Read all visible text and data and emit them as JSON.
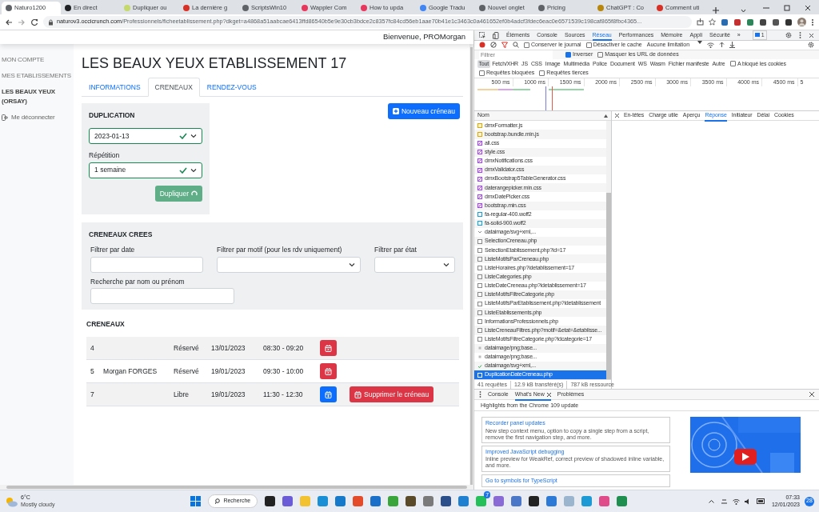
{
  "browser": {
    "tabs": [
      {
        "title": "Naturo1200",
        "selected": true,
        "color": "#5f6368"
      },
      {
        "title": "En direct",
        "selected": false,
        "color": "#202124"
      },
      {
        "title": "Dupliquer ou",
        "selected": false,
        "color": "#c5d96a"
      },
      {
        "title": "La dernière g",
        "selected": false,
        "color": "#d93025"
      },
      {
        "title": "ScriptsWin10",
        "selected": false,
        "color": "#5f6368"
      },
      {
        "title": "Wappler Com",
        "selected": false,
        "color": "#e8365d"
      },
      {
        "title": "How to upda",
        "selected": false,
        "color": "#e8365d"
      },
      {
        "title": "Google Tradu",
        "selected": false,
        "color": "#4285f4"
      },
      {
        "title": "Nouvel onglet",
        "selected": false,
        "color": "#5f6368"
      },
      {
        "title": "Pricing",
        "selected": false,
        "color": "#5f6368"
      },
      {
        "title": "ChatGPT : Co",
        "selected": false,
        "color": "#b8860b"
      },
      {
        "title": "Comment uti",
        "selected": false,
        "color": "#d93025"
      }
    ],
    "url_host": "naturov3.occicrunch.com",
    "url_rest": "/Professionnels/ficheetablissement.php?dkget=a4868a51aabcae6413ffd86540b5e9e30cb3bdce2c8357fc84cd56eb1aae70b41e1c3463c0a461652ef0b4adcf3fdec6eac0e6571539c198caf865f8fbc4365..."
  },
  "page": {
    "welcome": "Bienvenue, PROMorgan",
    "sidebar": [
      {
        "label": "MON COMPTE",
        "selected": false
      },
      {
        "label": "MES ETABLISSEMENTS",
        "selected": false
      },
      {
        "label": "LES BEAUX YEUX (ORSAY)",
        "selected": true
      }
    ],
    "logout": "Me déconnecter",
    "title": "LES BEAUX YEUX ETABLISSEMENT 17",
    "tabs": [
      {
        "label": "INFORMATIONS",
        "selected": false
      },
      {
        "label": "CRENEAUX",
        "selected": true
      },
      {
        "label": "RENDEZ-VOUS",
        "selected": false
      }
    ],
    "duplication": {
      "heading": "DUPLICATION",
      "date_value": "2023-01-13",
      "date_valid": true,
      "repetition_label": "Répétition",
      "repetition_value": "1 semaine",
      "repetition_valid": true,
      "button": "Dupliquer",
      "loading": true
    },
    "new_button": "Nouveau créneau",
    "filters": {
      "heading": "CRENEAUX CREES",
      "fields": [
        {
          "label": "Filtrer par date",
          "kind": "text"
        },
        {
          "label": "Filtrer par motif (pour les rdv uniquement)",
          "kind": "select"
        },
        {
          "label": "Filtrer par état",
          "kind": "select"
        },
        {
          "label": "Recherche par nom ou prénom",
          "kind": "text"
        }
      ]
    },
    "slots": {
      "heading": "CRENEAUX",
      "rows": [
        {
          "number": "4",
          "status": "Réservé",
          "date": "13/01/2023",
          "time": "08:30 - 09:20",
          "kind": "reserved"
        },
        {
          "number": "5",
          "name": "Morgan FORGES",
          "status": "Réservé",
          "date": "19/01/2023",
          "time": "09:30 - 10:00",
          "kind": "reserved"
        },
        {
          "number": "7",
          "status": "Libre",
          "date": "19/01/2023",
          "time": "11:30 - 12:30",
          "kind": "free",
          "delete_label": "Supprimer le créneau"
        }
      ]
    }
  },
  "devtools": {
    "panels": [
      {
        "label": "Éléments",
        "selected": false
      },
      {
        "label": "Console",
        "selected": false
      },
      {
        "label": "Sources",
        "selected": false
      },
      {
        "label": "Réseau",
        "selected": true
      },
      {
        "label": "Performances",
        "selected": false
      },
      {
        "label": "Mémoire",
        "selected": false
      },
      {
        "label": "Appli",
        "selected": false
      },
      {
        "label": "Sécurité",
        "selected": false
      },
      {
        "label": "»",
        "selected": false
      }
    ],
    "issues_count": "1",
    "toolbar_checks": [
      {
        "label": "Conserver le journal",
        "checked": false
      },
      {
        "label": "Désactiver le cache",
        "checked": false
      }
    ],
    "throttling": "Aucune limitation",
    "filter_placeholder": "Filtrer",
    "filter_checks": [
      {
        "label": "Inverser",
        "checked": true
      },
      {
        "label": "Masquer les URL de données",
        "checked": false
      }
    ],
    "types": [
      {
        "label": "Tout",
        "selected": true
      },
      {
        "label": "Fetch/XHR",
        "selected": false
      },
      {
        "label": "JS",
        "selected": false
      },
      {
        "label": "CSS",
        "selected": false
      },
      {
        "label": "Image",
        "selected": false
      },
      {
        "label": "Multimédia",
        "selected": false
      },
      {
        "label": "Police",
        "selected": false
      },
      {
        "label": "Document",
        "selected": false
      },
      {
        "label": "WS",
        "selected": false
      },
      {
        "label": "Wasm",
        "selected": false
      },
      {
        "label": "Fichier manifeste",
        "selected": false
      },
      {
        "label": "Autre",
        "selected": false
      }
    ],
    "cookie_check": {
      "label": "A bloqué les cookies",
      "checked": false
    },
    "request_checks": [
      {
        "label": "Requêtes bloquées",
        "checked": false
      },
      {
        "label": "Requêtes tierces",
        "checked": false
      }
    ],
    "ticks": [
      "500 ms",
      "1000 ms",
      "1500 ms",
      "2000 ms",
      "2500 ms",
      "3000 ms",
      "3500 ms",
      "4000 ms",
      "4500 ms",
      "5"
    ],
    "name_header": "Nom",
    "detail_tabs": [
      {
        "label": "En-têtes",
        "selected": false
      },
      {
        "label": "Charge utile",
        "selected": false
      },
      {
        "label": "Aperçu",
        "selected": false
      },
      {
        "label": "Réponse",
        "selected": true
      },
      {
        "label": "Initiateur",
        "selected": false
      },
      {
        "label": "Délai",
        "selected": false
      },
      {
        "label": "Cookies",
        "selected": false
      }
    ],
    "requests": [
      {
        "name": "dmxFormatter.js",
        "kind": "script",
        "selected": false
      },
      {
        "name": "bootstrap.bundle.min.js",
        "kind": "script",
        "selected": false
      },
      {
        "name": "all.css",
        "kind": "style",
        "selected": false
      },
      {
        "name": "style.css",
        "kind": "style",
        "selected": false
      },
      {
        "name": "dmxNotifications.css",
        "kind": "style",
        "selected": false
      },
      {
        "name": "dmxValidator.css",
        "kind": "style",
        "selected": false
      },
      {
        "name": "dmxBootstrap5TableGenerator.css",
        "kind": "style",
        "selected": false
      },
      {
        "name": "daterangepicker.min.css",
        "kind": "style",
        "selected": false
      },
      {
        "name": "dmxDatePicker.css",
        "kind": "style",
        "selected": false
      },
      {
        "name": "bootstrap.min.css",
        "kind": "style",
        "selected": false
      },
      {
        "name": "fa-regular-400.woff2",
        "kind": "font",
        "selected": false
      },
      {
        "name": "fa-solid-900.woff2",
        "kind": "font",
        "selected": false
      },
      {
        "name": "dataimage/svg+xml,...",
        "kind": "svg",
        "selected": false
      },
      {
        "name": "SelectionCreneau.php",
        "kind": "doc",
        "selected": false
      },
      {
        "name": "SelectionEtablissement.php?id=17",
        "kind": "doc",
        "selected": false
      },
      {
        "name": "ListeMotifsParCreneau.php",
        "kind": "doc",
        "selected": false
      },
      {
        "name": "ListeHoraires.php?idetablissement=17",
        "kind": "doc",
        "selected": false
      },
      {
        "name": "ListeCategories.php",
        "kind": "doc",
        "selected": false
      },
      {
        "name": "ListeDateCreneau.php?idetablissement=17",
        "kind": "doc",
        "selected": false
      },
      {
        "name": "ListeMotifsFiltreCategorie.php",
        "kind": "doc",
        "selected": false
      },
      {
        "name": "ListeMotifsParEtablissement.php?idetablissement",
        "kind": "doc",
        "selected": false
      },
      {
        "name": "ListeEtablissements.php",
        "kind": "doc",
        "selected": false
      },
      {
        "name": "InformationsProfessionnels.php",
        "kind": "doc",
        "selected": false
      },
      {
        "name": "ListeCreneauFiltres.php?motif=&etat=&etablisse...",
        "kind": "doc",
        "selected": false
      },
      {
        "name": "ListeMotifsFiltreCategorie.php?idcategorie=17",
        "kind": "doc",
        "selected": false
      },
      {
        "name": "dataimage/png;base...",
        "kind": "png",
        "selected": false
      },
      {
        "name": "dataimage/png;base...",
        "kind": "png",
        "selected": false
      },
      {
        "name": "dataimage/svg+xml,...",
        "kind": "check",
        "selected": false
      },
      {
        "name": "DuplicationDateCreneau.php",
        "kind": "doc",
        "selected": true
      }
    ],
    "status": [
      "41 requêtes",
      "12.9 kB transféré(s)",
      "787 kB ressource"
    ],
    "drawer_tabs": [
      {
        "label": "Console",
        "selected": false
      },
      {
        "label": "What's New",
        "selected": true
      },
      {
        "label": "Problèmes",
        "selected": false
      }
    ],
    "drawer_header": "Highlights from the Chrome 109 update",
    "cards": [
      {
        "title": "Recorder panel updates",
        "body": "New step context menu, option to copy a single step from a script, remove the first navigation step, and more."
      },
      {
        "title": "Improved JavaScript debugging",
        "body": "Inline preview for WeakRef, correct preview of shadowed inline variable, and more."
      },
      {
        "title": "Go to symbols for TypeScript"
      }
    ]
  },
  "taskbar": {
    "temperature": "6°C",
    "weather": "Mostly cloudy",
    "search": "Recherche",
    "whatsapp_badge": "7",
    "time": "07:33",
    "date": "12/01/2023",
    "notifications": "28"
  }
}
